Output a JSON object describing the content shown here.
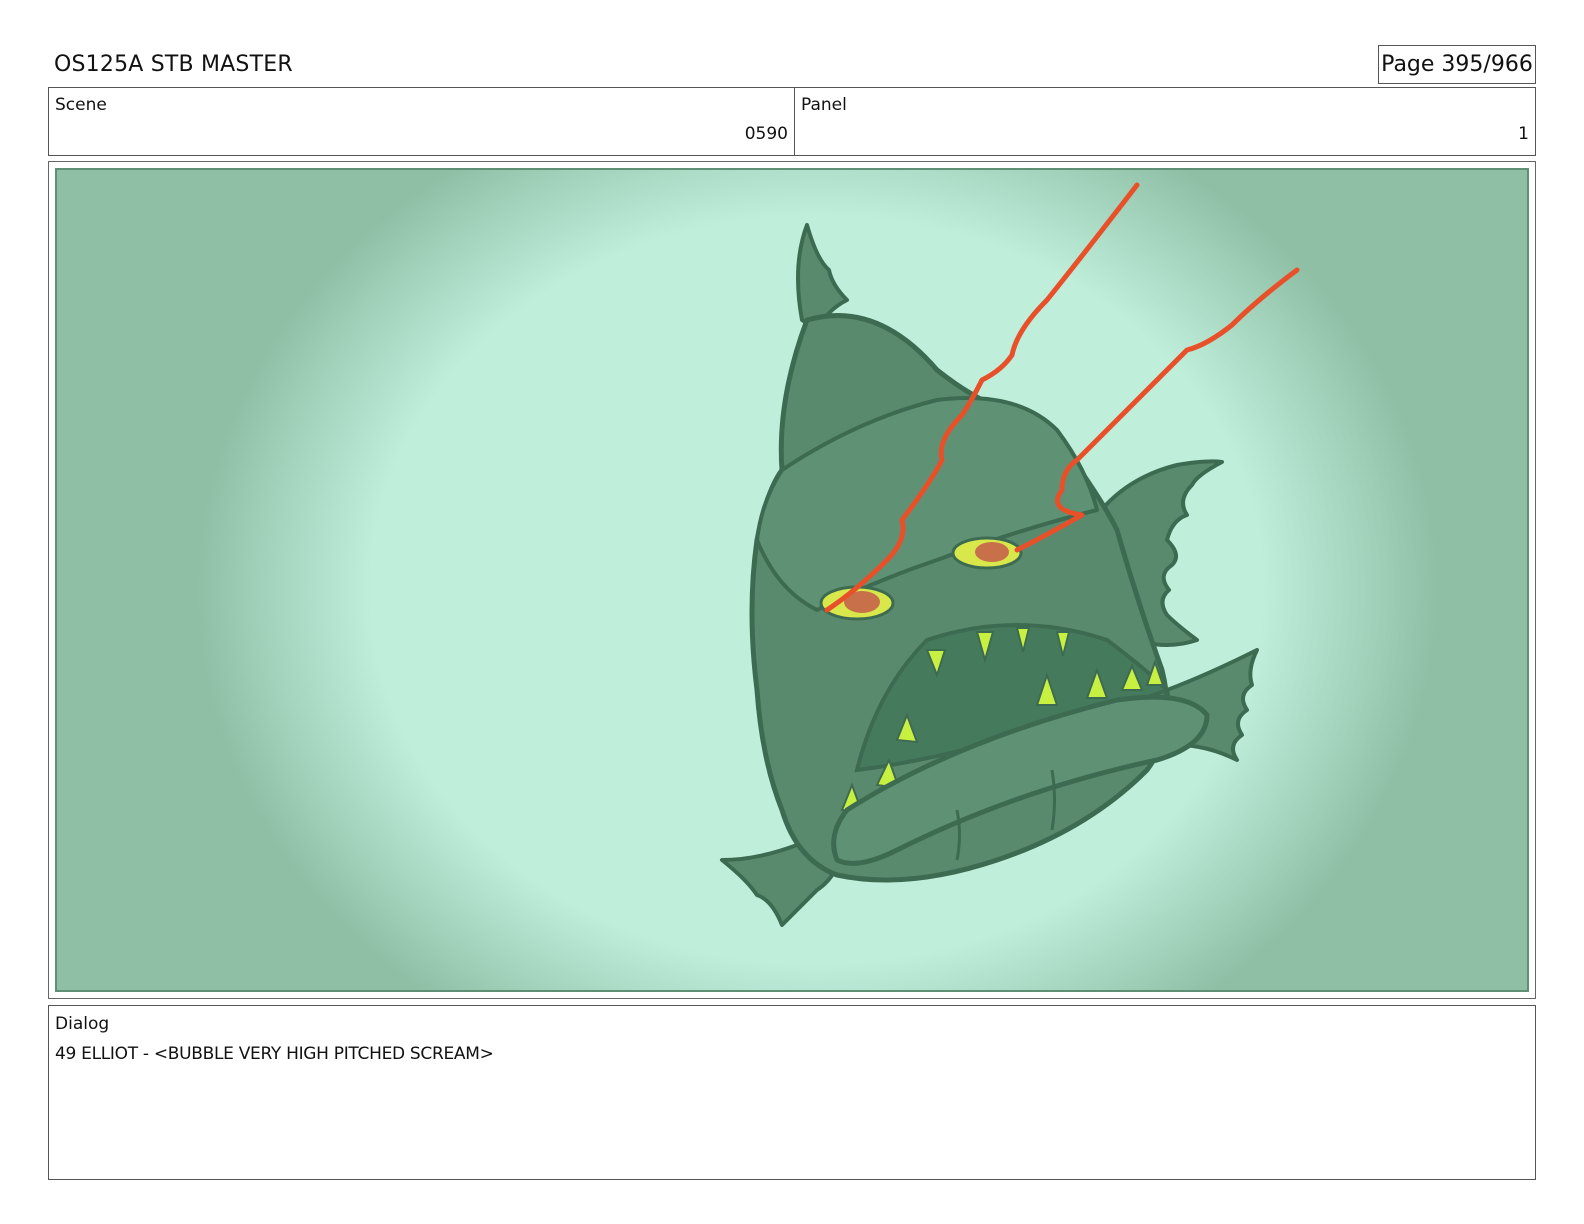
{
  "document": {
    "title": "OS125A STB MASTER",
    "page": "Page 395/966"
  },
  "header": {
    "scene_label": "Scene",
    "scene_value": "0590",
    "panel_label": "Panel",
    "panel_value": "1"
  },
  "frame": {
    "illustration": "angry-green-fish-with-red-lightning-icon",
    "colors": {
      "water_light": "#bfeedb",
      "water_dark": "#8fc0a6",
      "fish_body": "#5a8a6e",
      "fish_outline": "#3d6b52",
      "eye": "#d8e84a",
      "pupil": "#c8704a",
      "teeth": "#c8f040",
      "lightning": "#e8502a"
    }
  },
  "dialog": {
    "label": "Dialog",
    "text": "49 ELLIOT - <BUBBLE VERY HIGH PITCHED SCREAM>"
  }
}
